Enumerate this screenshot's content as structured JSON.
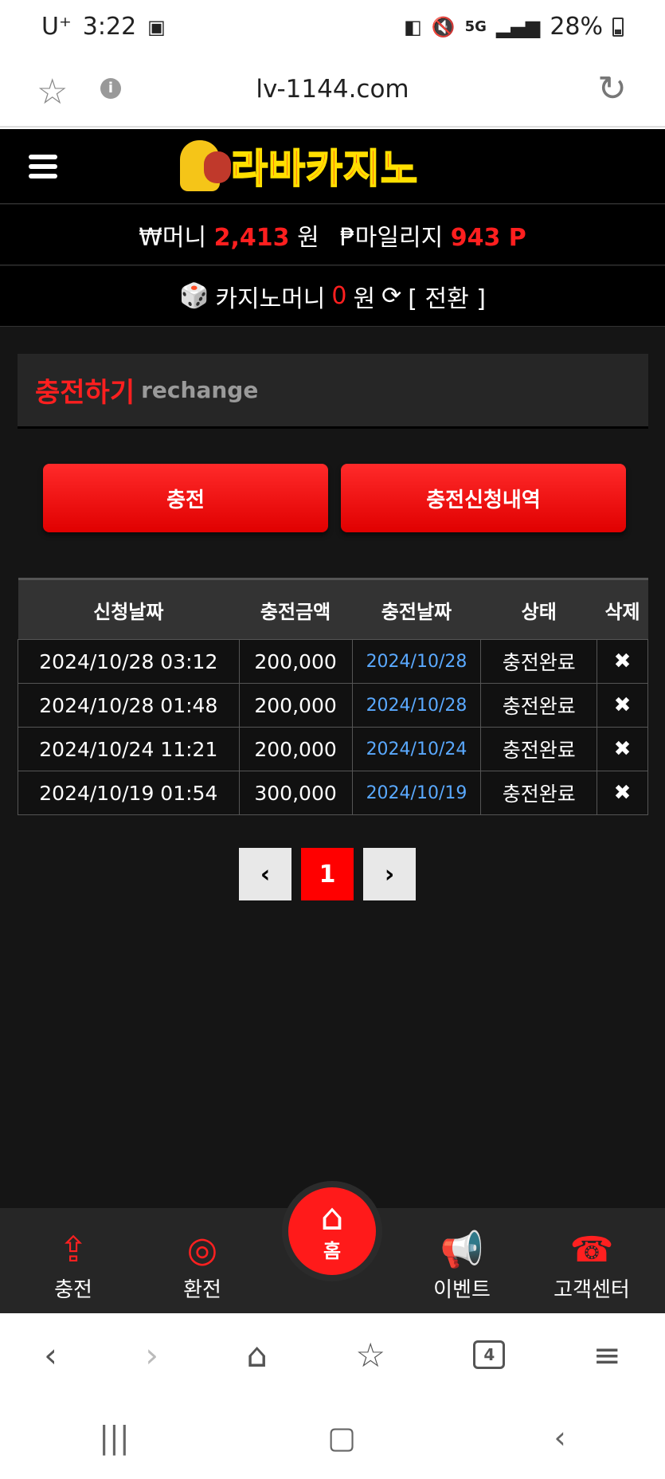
{
  "status_bar": {
    "carrier": "U⁺",
    "time": "3:22",
    "network": "5G",
    "battery": "28%"
  },
  "browser": {
    "url": "lv-1144.com",
    "tabs_count": "4"
  },
  "site": {
    "logo_text": "라바카지노",
    "money_label": "₩머니",
    "money_value": "2,413",
    "money_unit": "원",
    "mileage_label": "₱마일리지",
    "mileage_value": "943 P",
    "casino_label": "카지노머니",
    "casino_value": "0",
    "casino_unit": "원",
    "convert_label": "[ 전환 ]",
    "panel_title_ko": "충전하기",
    "panel_title_en": "rechange",
    "btn_charge": "충전",
    "btn_history": "충전신청내역"
  },
  "table": {
    "headers": [
      "신청날짜",
      "충전금액",
      "충전날짜",
      "상태",
      "삭제"
    ],
    "rows": [
      {
        "request_date": "2024/10/28 03:12",
        "amount": "200,000",
        "charge_date": "2024/10/28",
        "status": "충전완료",
        "delete": "✖"
      },
      {
        "request_date": "2024/10/28 01:48",
        "amount": "200,000",
        "charge_date": "2024/10/28",
        "status": "충전완료",
        "delete": "✖"
      },
      {
        "request_date": "2024/10/24 11:21",
        "amount": "200,000",
        "charge_date": "2024/10/24",
        "status": "충전완료",
        "delete": "✖"
      },
      {
        "request_date": "2024/10/19 01:54",
        "amount": "300,000",
        "charge_date": "2024/10/19",
        "status": "충전완료",
        "delete": "✖"
      }
    ]
  },
  "pager": {
    "prev": "‹",
    "current": "1",
    "next": "›"
  },
  "bottom_nav": {
    "charge": "충전",
    "exchange": "환전",
    "home": "홈",
    "event": "이벤트",
    "support": "고객센터"
  },
  "colors": {
    "accent": "#ff1f1f",
    "link": "#5aa9ff",
    "bg": "#151515"
  }
}
